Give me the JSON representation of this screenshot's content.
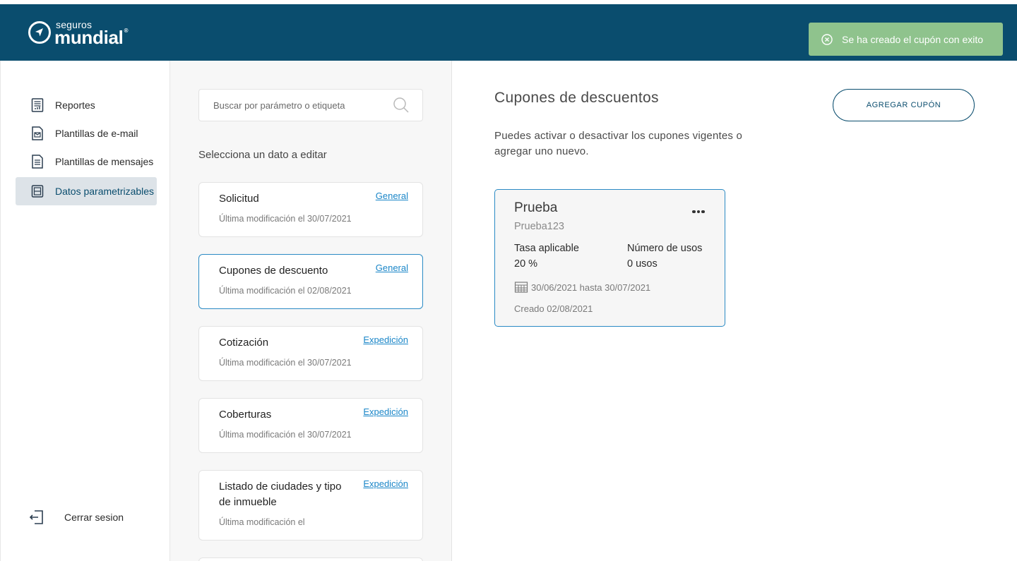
{
  "brand": {
    "small": "seguros",
    "big": "mundial",
    "reg": "®"
  },
  "toast": {
    "message": "Se ha creado el cupón con exito"
  },
  "sidebar": {
    "items": [
      {
        "label": "Reportes",
        "icon": "report-icon"
      },
      {
        "label": "Plantillas de e-mail",
        "icon": "email-template-icon"
      },
      {
        "label": "Plantillas de mensajes",
        "icon": "message-template-icon"
      },
      {
        "label": "Datos parametrizables",
        "icon": "database-icon",
        "active": true
      }
    ],
    "logout": "Cerrar sesion"
  },
  "middle": {
    "search_placeholder": "Buscar por parámetro o etiqueta",
    "section_title": "Selecciona un dato a editar",
    "cards": [
      {
        "title": "Solicitud",
        "tag": "General",
        "meta": "Última modificación el 30/07/2021"
      },
      {
        "title": "Cupones de descuento",
        "tag": "General",
        "meta": "Última modificación el 02/08/2021"
      },
      {
        "title": "Cotización",
        "tag": "Expedición",
        "meta": "Última modificación el 30/07/2021"
      },
      {
        "title": "Coberturas",
        "tag": "Expedición",
        "meta": "Última modificación el 30/07/2021"
      },
      {
        "title_line1": "Listado de ciudades y tipo",
        "title_line2": "de inmueble",
        "tag": "Expedición",
        "meta": "Última modificación el"
      }
    ]
  },
  "main": {
    "title": "Cupones de descuentos",
    "description_line1": "Puedes activar o desactivar los cupones vigentes o",
    "description_line2": "agregar uno nuevo.",
    "add_button": "AGREGAR CUPÓN",
    "coupon": {
      "name": "Prueba",
      "code": "Prueba123",
      "rate_label": "Tasa aplicable",
      "rate_value": "20 %",
      "uses_label": "Número de usos",
      "uses_value": "0 usos",
      "date_range": "30/06/2021 hasta 30/07/2021",
      "created": "Creado 02/08/2021"
    }
  }
}
